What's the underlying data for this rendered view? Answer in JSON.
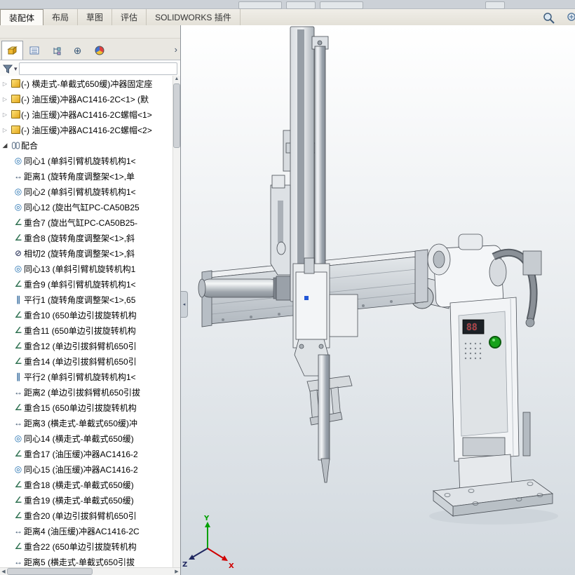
{
  "command_tabs": [
    {
      "label": "装配体",
      "active": true
    },
    {
      "label": "布局",
      "active": false
    },
    {
      "label": "草图",
      "active": false
    },
    {
      "label": "评估",
      "active": false
    },
    {
      "label": "SOLIDWORKS 插件",
      "active": false
    }
  ],
  "left_panel": {
    "filter": {
      "value": ""
    },
    "tree": {
      "components": [
        {
          "label": "(-) 横走式-单截式650缓)冲器固定座",
          "icon": "part"
        },
        {
          "label": "(-) 油压缓)冲器AC1416-2C<1> (默",
          "icon": "part"
        },
        {
          "label": "(-) 油压缓)冲器AC1416-2C螺帽<1>",
          "icon": "part"
        },
        {
          "label": "(-) 油压缓)冲器AC1416-2C螺帽<2>",
          "icon": "part"
        }
      ],
      "mates_group": {
        "label": "配合"
      },
      "mates": [
        {
          "label": "同心1 (单斜引臂机旋转机构1<",
          "type": "concentric"
        },
        {
          "label": "距离1 (旋转角度调整架<1>,单",
          "type": "distance"
        },
        {
          "label": "同心2 (单斜引臂机旋转机构1<",
          "type": "concentric"
        },
        {
          "label": "同心12 (旋出气缸PC-CA50B25",
          "type": "concentric"
        },
        {
          "label": "重合7 (旋出气缸PC-CA50B25-",
          "type": "coincident"
        },
        {
          "label": "重合8 (旋转角度调整架<1>,斜",
          "type": "coincident"
        },
        {
          "label": "相切2 (旋转角度调整架<1>,斜",
          "type": "tangent"
        },
        {
          "label": "同心13 (单斜引臂机旋转机构1",
          "type": "concentric"
        },
        {
          "label": "重合9 (单斜引臂机旋转机构1<",
          "type": "coincident"
        },
        {
          "label": "平行1 (旋转角度调整架<1>,65",
          "type": "parallel"
        },
        {
          "label": "重合10 (650单边引拔旋转机构",
          "type": "coincident"
        },
        {
          "label": "重合11 (650单边引拔旋转机构",
          "type": "coincident"
        },
        {
          "label": "重合12 (单边引拔斜臂机650引",
          "type": "coincident"
        },
        {
          "label": "重合14 (单边引拔斜臂机650引",
          "type": "coincident"
        },
        {
          "label": "平行2 (单斜引臂机旋转机构1<",
          "type": "parallel"
        },
        {
          "label": "距离2 (单边引拔斜臂机650引拔",
          "type": "distance"
        },
        {
          "label": "重合15 (650单边引拔旋转机构",
          "type": "coincident"
        },
        {
          "label": "距离3 (横走式-单截式650缓)冲",
          "type": "distance"
        },
        {
          "label": "同心14 (横走式-单截式650缓)",
          "type": "concentric"
        },
        {
          "label": "重合17 (油压缓)冲器AC1416-2",
          "type": "coincident"
        },
        {
          "label": "同心15 (油压缓)冲器AC1416-2",
          "type": "concentric"
        },
        {
          "label": "重合18 (横走式-单截式650缓)",
          "type": "coincident"
        },
        {
          "label": "重合19 (横走式-单截式650缓)",
          "type": "coincident"
        },
        {
          "label": "重合20 (单边引拔斜臂机650引",
          "type": "coincident"
        },
        {
          "label": "距离4 (油压缓)冲器AC1416-2C",
          "type": "distance"
        },
        {
          "label": "重合22 (650单边引拔旋转机构",
          "type": "coincident"
        },
        {
          "label": "距离5 (横走式-单截式650引拔",
          "type": "distance"
        }
      ]
    }
  },
  "viewport": {
    "triad": {
      "x_label": "X",
      "y_label": "Y",
      "z_label": "Z"
    },
    "led_display_value": "88"
  },
  "glyphs": {
    "collapsed_arrow": "▷",
    "expanded_arrow": "◢",
    "panel_chevron": "›",
    "filter_caret": "▾",
    "target_tab_icon": "⊕",
    "scroll_up": "▲",
    "scroll_left": "◀",
    "scroll_right": "▶",
    "collapse_handle": "◂",
    "mate_icons": {
      "concentric": {
        "glyph": "◎",
        "color": "#1f6fb0"
      },
      "distance": {
        "glyph": "↔",
        "color": "#38506b"
      },
      "coincident": {
        "glyph": "∠",
        "color": "#2e7050"
      },
      "parallel": {
        "glyph": "∥",
        "color": "#3a6fa0"
      },
      "tangent": {
        "glyph": "⊘",
        "color": "#41496b"
      }
    }
  }
}
